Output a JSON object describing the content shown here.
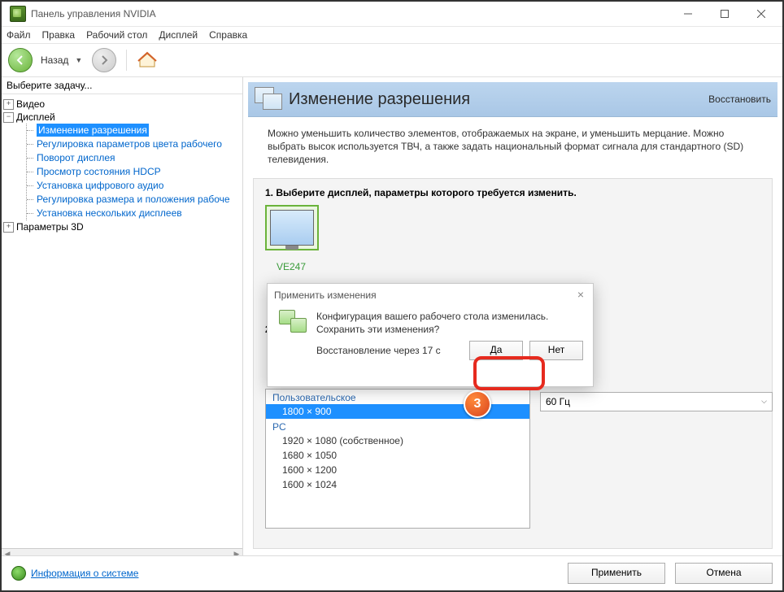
{
  "window": {
    "title": "Панель управления NVIDIA"
  },
  "menu": {
    "file": "Файл",
    "edit": "Правка",
    "desktop": "Рабочий стол",
    "display": "Дисплей",
    "help": "Справка"
  },
  "toolbar": {
    "back": "Назад"
  },
  "sidebar": {
    "header": "Выберите задачу...",
    "nodes": {
      "video": "Видео",
      "display": "Дисплей",
      "params3d": "Параметры 3D"
    },
    "display_leaves": {
      "l0": "Изменение разрешения",
      "l1": "Регулировка параметров цвета рабочего",
      "l2": "Поворот дисплея",
      "l3": "Просмотр состояния HDCP",
      "l4": "Установка цифрового аудио",
      "l5": "Регулировка размера и положения рабоче",
      "l6": "Установка нескольких дисплеев"
    }
  },
  "content": {
    "title": "Изменение разрешения",
    "restore": "Восстановить",
    "desc": "Можно уменьшить количество элементов, отображаемых на экране, и уменьшить мерцание. Можно выбрать высок используется ТВЧ, а также задать национальный формат сигнала для стандартного (SD) телевидения.",
    "step1": "1. Выберите дисплей, параметры которого требуется изменить.",
    "display_name": "VE247",
    "step2_num": "2.",
    "resolutions": {
      "group1": "Пользовательское",
      "r0": "1800 × 900",
      "group2": "PC",
      "r1": "1920 × 1080 (собственное)",
      "r2": "1680 × 1050",
      "r3": "1600 × 1200",
      "r4": "1600 × 1024"
    },
    "refresh": "60 Гц"
  },
  "dialog": {
    "title": "Применить изменения",
    "line1": "Конфигурация вашего рабочего стола изменилась.",
    "line2": "Сохранить эти изменения?",
    "countdown": "Восстановление через 17 с",
    "yes": "Да",
    "no": "Нет"
  },
  "footer": {
    "syslink": "Информация о системе",
    "apply": "Применить",
    "cancel": "Отмена"
  },
  "badge": {
    "n3": "3"
  }
}
